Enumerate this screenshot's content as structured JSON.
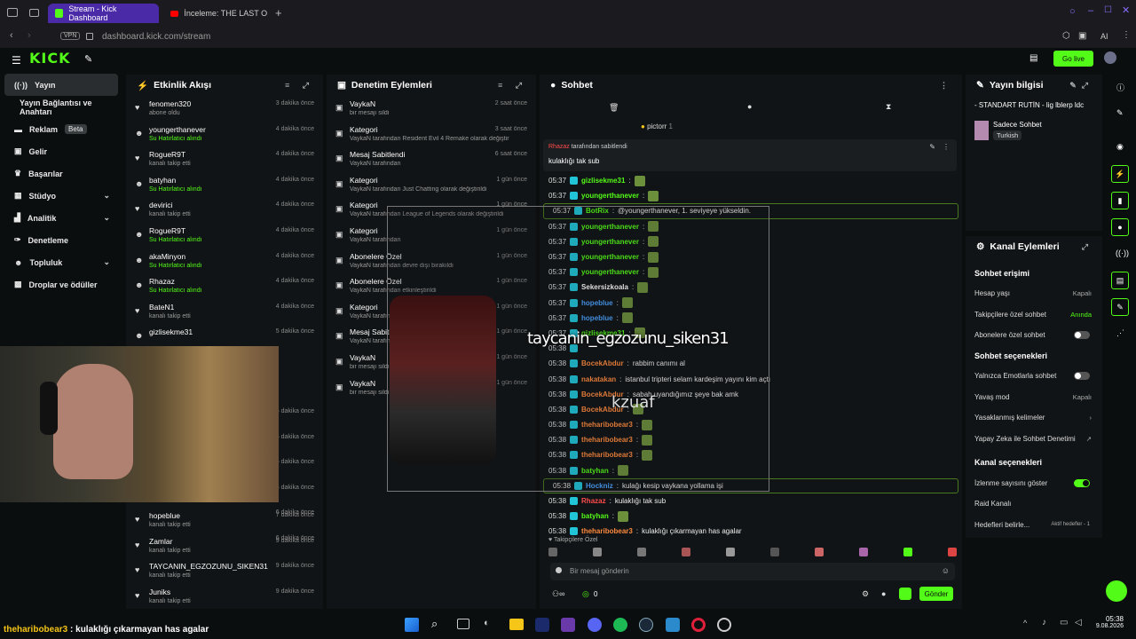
{
  "browser": {
    "tabs": [
      {
        "label": "Stream - Kick Dashboard"
      },
      {
        "label": "İnceleme: THE LAST OF US"
      }
    ],
    "url": "dashboard.kick.com/stream",
    "vpn": "VPN",
    "ai": "AI"
  },
  "header": {
    "go_live": "Go live"
  },
  "sidebar": {
    "items": [
      {
        "label": "Yayın"
      },
      {
        "label": "Yayın Bağlantısı ve Anahtarı"
      },
      {
        "label": "Reklam",
        "badge": "Beta"
      },
      {
        "label": "Gelir"
      },
      {
        "label": "Başarılar"
      },
      {
        "label": "Stüdyo"
      },
      {
        "label": "Analitik"
      },
      {
        "label": "Denetleme"
      },
      {
        "label": "Topluluk"
      },
      {
        "label": "Droplar ve ödüller"
      }
    ]
  },
  "activity": {
    "title": "Etkinlik Akışı",
    "items": [
      {
        "name": "fenomen320",
        "sub": "abone oldu",
        "time": "3 dakika önce"
      },
      {
        "name": "youngerthanever",
        "sub": "Su Hatırlatıcı alındı",
        "time": "4 dakika önce"
      },
      {
        "name": "RogueR9T",
        "sub": "kanalı takip etti",
        "time": "4 dakika önce"
      },
      {
        "name": "batyhan",
        "sub": "Su Hatırlatıcı alındı",
        "time": "4 dakika önce"
      },
      {
        "name": "devirici",
        "sub": "kanalı takip etti",
        "time": "4 dakika önce"
      },
      {
        "name": "RogueR9T",
        "sub": "Su Hatırlatıcı alındı",
        "time": "4 dakika önce"
      },
      {
        "name": "akaMinyon",
        "sub": "Su Hatırlatıcı alındı",
        "time": "4 dakika önce"
      },
      {
        "name": "Rhazaz",
        "sub": "Su Hatırlatıcı alındı",
        "time": "4 dakika önce"
      },
      {
        "name": "BateN1",
        "sub": "kanalı takip etti",
        "time": "4 dakika önce"
      },
      {
        "name": "gizlisekme31",
        "sub": "",
        "time": "5 dakika önce"
      }
    ],
    "tail": [
      {
        "name": "hopeblue",
        "sub": "kanalı takip etti",
        "time": "7 dakika önce"
      },
      {
        "name": "Zamlar",
        "sub": "kanalı takip etti",
        "time": "9 dakika önce"
      },
      {
        "name": "TAYCANIN_EGZOZUNU_SIKEN31",
        "sub": "kanalı takip etti",
        "time": "9 dakika önce"
      },
      {
        "name": "Juniks",
        "sub": "kanalı takip etti",
        "time": "9 dakika önce"
      }
    ],
    "side_times": [
      "6 dakika önce",
      "6 dakika önce",
      "6 dakika önce",
      "6 dakika önce",
      "6 dakika önce",
      "6 dakika önce"
    ]
  },
  "moderation": {
    "title": "Denetim Eylemleri",
    "items": [
      {
        "name": "VaykaN",
        "sub": "bir mesajı sildi",
        "time": "2 saat önce"
      },
      {
        "name": "Kategori",
        "sub": "VaykaN tarafından Resident Evil 4 Remake olarak değiştirildi",
        "time": "3 saat önce"
      },
      {
        "name": "Mesaj Sabitlendi",
        "sub": "VaykaN tarafından",
        "time": "6 saat önce"
      },
      {
        "name": "Kategori",
        "sub": "VaykaN tarafından Just Chatting olarak değiştirildi",
        "time": "1 gün önce"
      },
      {
        "name": "Kategori",
        "sub": "VaykaN tarafından League of Legends olarak değiştirildi",
        "time": "1 gün önce"
      },
      {
        "name": "Kategori",
        "sub": "VaykaN tarafından",
        "time": "1 gün önce"
      },
      {
        "name": "Abonelere Özel",
        "sub": "VaykaN tarafından devre dışı bırakıldı",
        "time": "1 gün önce"
      },
      {
        "name": "Abonelere Özel",
        "sub": "VaykaN tarafından etkinleştirildi",
        "time": "1 gün önce"
      },
      {
        "name": "Kategori",
        "sub": "VaykaN tarafından",
        "time": "1 gün önce"
      },
      {
        "name": "Mesaj Sabitle",
        "sub": "VaykaN tarafından",
        "time": "1 gün önce"
      },
      {
        "name": "VaykaN",
        "sub": "bir mesajı sildi",
        "time": "1 gün önce"
      },
      {
        "name": "VaykaN",
        "sub": "bir mesajı sildi",
        "time": "1 gün önce"
      }
    ]
  },
  "chat": {
    "title": "Sohbet",
    "pinned_top": "pictorr",
    "pinned_by": "Rhazaz",
    "pinned_by_suffix": "tarafından sabitlendi",
    "pinned_msg": "kulaklığı tak sub",
    "messages": [
      {
        "time": "05:37",
        "user": "gizlisekme31",
        "color": "#53fc18",
        "text": ""
      },
      {
        "time": "05:37",
        "user": "youngerthanever",
        "color": "#53fc18",
        "text": ""
      },
      {
        "time": "05:37",
        "user": "BotRix",
        "color": "#53fc18",
        "text": "@youngerthanever, 1. seviyeye yükseldin."
      },
      {
        "time": "05:37",
        "user": "youngerthanever",
        "color": "#53fc18",
        "text": ""
      },
      {
        "time": "05:37",
        "user": "youngerthanever",
        "color": "#53fc18",
        "text": ""
      },
      {
        "time": "05:37",
        "user": "youngerthanever",
        "color": "#53fc18",
        "text": ""
      },
      {
        "time": "05:37",
        "user": "youngerthanever",
        "color": "#53fc18",
        "text": ""
      },
      {
        "time": "05:37",
        "user": "Sekersizkoala",
        "color": "#ffffff",
        "text": ""
      },
      {
        "time": "05:37",
        "user": "hopeblue",
        "color": "#4aa3ff",
        "text": ""
      },
      {
        "time": "05:37",
        "user": "hopeblue",
        "color": "#4aa3ff",
        "text": ""
      },
      {
        "time": "05:37",
        "user": "gizlisekme31",
        "color": "#53fc18",
        "text": ""
      },
      {
        "time": "05:38",
        "user": "",
        "color": "#ffffff",
        "text": ""
      },
      {
        "time": "05:38",
        "user": "BocekAbdur",
        "color": "#ff8a3d",
        "text": "rabbim canımı al"
      },
      {
        "time": "05:38",
        "user": "nakatakan",
        "color": "#ff8a3d",
        "text": "istanbul tripteri selam kardeşim yayını kim açtı"
      },
      {
        "time": "05:38",
        "user": "BocekAbdur",
        "color": "#ff8a3d",
        "text": "sabah uyandığımız şeye bak amk"
      },
      {
        "time": "05:38",
        "user": "BocekAbdur",
        "color": "#ff8a3d",
        "text": ""
      },
      {
        "time": "05:38",
        "user": "theharibobear3",
        "color": "#ff8a3d",
        "text": ""
      },
      {
        "time": "05:38",
        "user": "theharibobear3",
        "color": "#ff8a3d",
        "text": ""
      },
      {
        "time": "05:38",
        "user": "theharibobear3",
        "color": "#ff8a3d",
        "text": ""
      },
      {
        "time": "05:38",
        "user": "batyhan",
        "color": "#53fc18",
        "text": ""
      },
      {
        "time": "05:38",
        "user": "Hockniz",
        "color": "#4aa3ff",
        "text": "kulağı kesip vaykana yollama işi"
      },
      {
        "time": "05:38",
        "user": "Rhazaz",
        "color": "#ff4b4b",
        "text": "kulaklığı tak sub"
      },
      {
        "time": "05:38",
        "user": "batyhan",
        "color": "#53fc18",
        "text": ""
      },
      {
        "time": "05:38",
        "user": "theharibobear3",
        "color": "#ff8a3d",
        "text": "kulaklığı çıkarmayan has agalar"
      }
    ],
    "followers_only": "Takipçilere Özel",
    "placeholder": "Bir mesaj gönderin",
    "count": "0",
    "send": "Gönder",
    "overlay_text": "taycanin_egzozunu_siken31",
    "overlay_user": "kzuaf"
  },
  "stream_info": {
    "title": "Yayın bilgisi",
    "stream_title": "- STANDART RUTİN - lig lblerp ldc",
    "category": "Sadece Sohbet",
    "tag": "Turkish"
  },
  "channel_actions": {
    "title": "Kanal Eylemleri",
    "chat_access": "Sohbet erişimi",
    "rows1": [
      {
        "label": "Hesap yaşı",
        "value": "Kapalı"
      },
      {
        "label": "Takipçilere özel sohbet",
        "value": "Anında"
      },
      {
        "label": "Abonelere özel sohbet",
        "value": ""
      }
    ],
    "chat_options": "Sohbet seçenekleri",
    "rows2": [
      {
        "label": "Yalnızca Emotlarla sohbet",
        "value": ""
      },
      {
        "label": "Yavaş mod",
        "value": "Kapalı"
      },
      {
        "label": "Yasaklanmış kelimeler",
        "value": ""
      },
      {
        "label": "Yapay Zeka ile Sohbet Denetimi",
        "value": ""
      }
    ],
    "channel_options": "Kanal seçenekleri",
    "rows3": [
      {
        "label": "İzlenme sayısını göster",
        "value": ""
      },
      {
        "label": "Raid Kanalı",
        "value": ""
      },
      {
        "label": "Hedefleri belirle...",
        "value": "Aktif hedefler - 1"
      }
    ]
  },
  "caption": {
    "user": "theharibobear3",
    "text": ": kulaklığı çıkarmayan has agalar"
  },
  "clock": {
    "time": "05:38",
    "date": "9.08.2026"
  }
}
